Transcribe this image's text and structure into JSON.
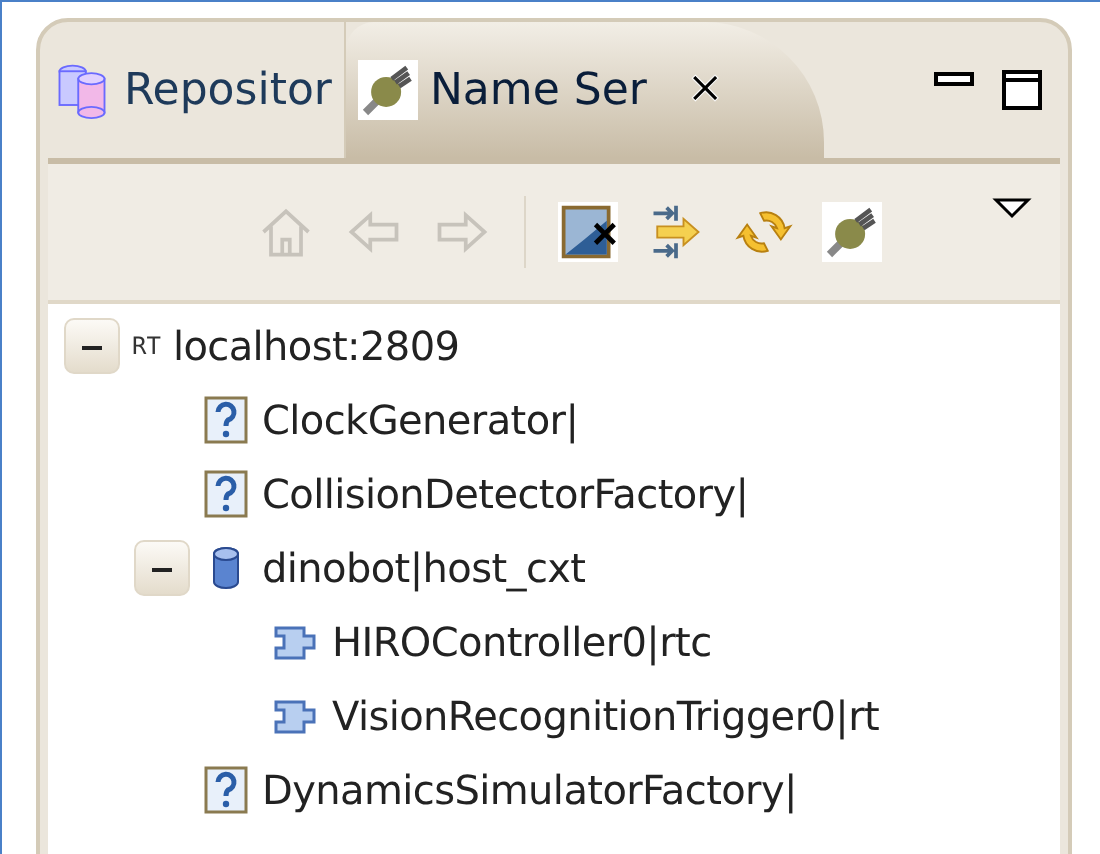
{
  "tabs": [
    {
      "label": "Repositor",
      "selected": false
    },
    {
      "label": "Name Ser",
      "selected": true,
      "close_label": "✕"
    }
  ],
  "toolbar": [
    {
      "kind": "button",
      "disabled": true
    },
    {
      "kind": "button",
      "disabled": true
    },
    {
      "kind": "button",
      "disabled": true
    },
    {
      "kind": "separator"
    },
    {
      "kind": "button",
      "disabled": false
    },
    {
      "kind": "button",
      "disabled": false
    },
    {
      "kind": "button",
      "disabled": false
    },
    {
      "kind": "button",
      "disabled": false
    }
  ],
  "tree": [
    {
      "label": "localhost:2809",
      "kind": "server",
      "badge": "RT",
      "expanded": true,
      "children": [
        {
          "label": "ClockGenerator|",
          "kind": "unknown"
        },
        {
          "label": "CollisionDetectorFactory|",
          "kind": "unknown"
        },
        {
          "label": "dinobot|host_cxt",
          "kind": "context",
          "expanded": true,
          "children": [
            {
              "label": "HIROController0|rtc",
              "kind": "component"
            },
            {
              "label": "VisionRecognitionTrigger0|rt",
              "kind": "component"
            }
          ]
        },
        {
          "label": "DynamicsSimulatorFactory|",
          "kind": "unknown"
        }
      ]
    }
  ]
}
